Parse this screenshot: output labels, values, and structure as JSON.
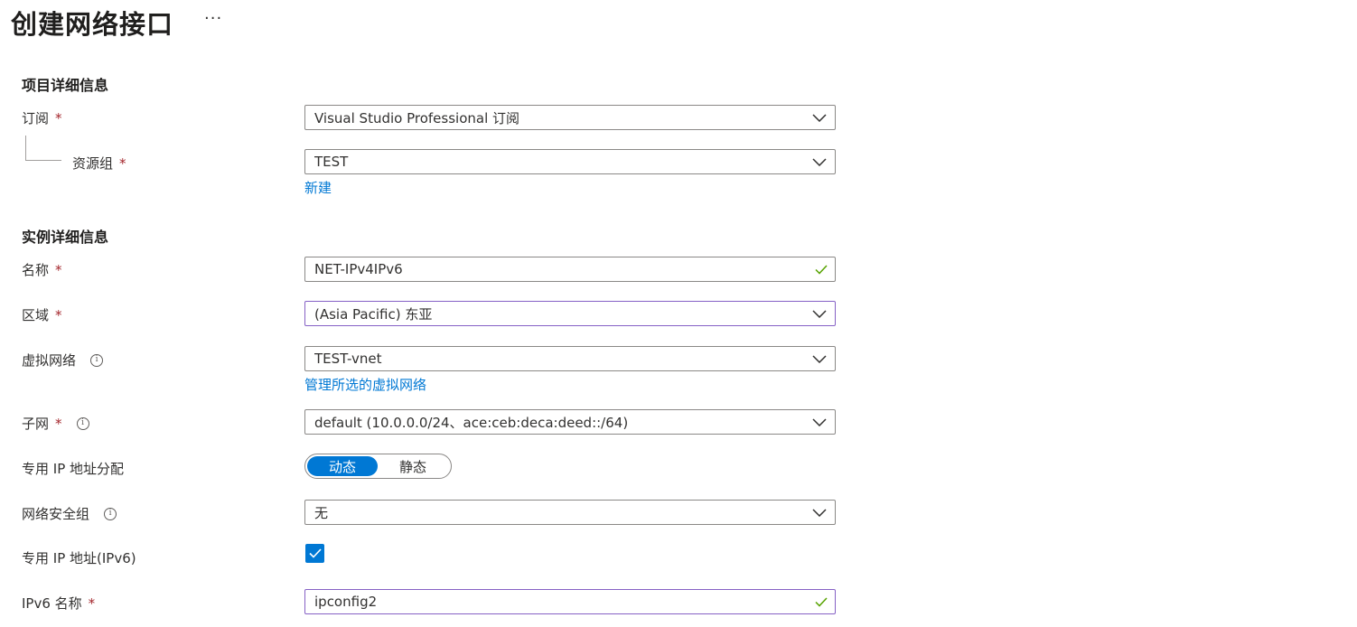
{
  "header": {
    "title": "创建网络接口",
    "more_label": "···"
  },
  "sections": {
    "project": "项目详细信息",
    "instance": "实例详细信息"
  },
  "required_mark": "*",
  "info_glyph": "i",
  "subscription": {
    "label": "订阅",
    "value": "Visual Studio Professional 订阅"
  },
  "resource_group": {
    "label": "资源组",
    "value": "TEST",
    "create_link": "新建"
  },
  "name": {
    "label": "名称",
    "value": "NET-IPv4IPv6"
  },
  "region": {
    "label": "区域",
    "value": "(Asia Pacific) 东亚"
  },
  "vnet": {
    "label": "虚拟网络",
    "value": "TEST-vnet",
    "manage_link": "管理所选的虚拟网络"
  },
  "subnet": {
    "label": "子网",
    "value": "default (10.0.0.0/24、ace:ceb:deca:deed::/64)"
  },
  "ip_assignment": {
    "label": "专用 IP 地址分配",
    "options": [
      "动态",
      "静态"
    ],
    "selected": "动态"
  },
  "nsg": {
    "label": "网络安全组",
    "value": "无"
  },
  "ipv6": {
    "label": "专用 IP 地址(IPv6)",
    "checked": true
  },
  "ipv6_name": {
    "label": "IPv6 名称",
    "value": "ipconfig2"
  },
  "colors": {
    "accent": "#0078d4",
    "required": "#a4262c",
    "valid": "#57a300",
    "focus_border": "#8661c5"
  }
}
